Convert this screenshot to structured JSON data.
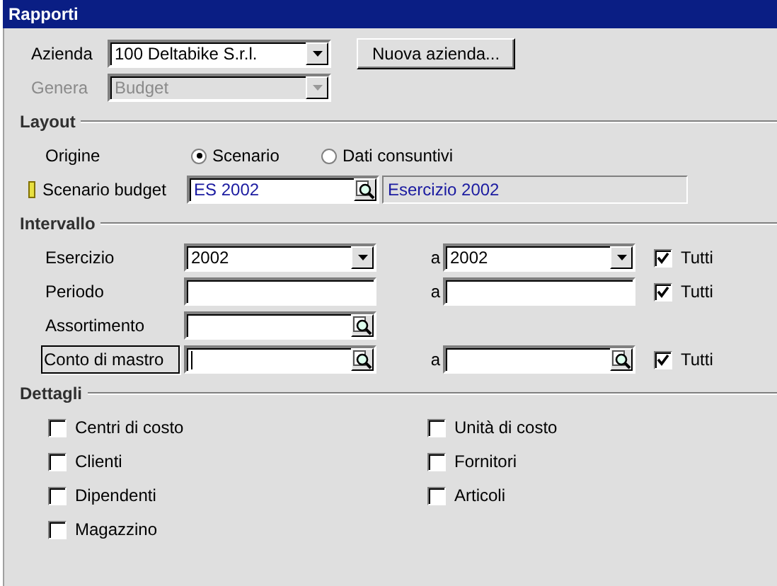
{
  "window": {
    "title": "Rapporti"
  },
  "header": {
    "azienda": {
      "label": "Azienda",
      "value": "100 Deltabike S.r.l.",
      "disabled": false
    },
    "new_button": "Nuova azienda...",
    "genera": {
      "label": "Genera",
      "value": "Budget",
      "disabled": true
    }
  },
  "layout": {
    "title": "Layout",
    "origine": {
      "label": "Origine",
      "options": [
        {
          "label": "Scenario",
          "selected": true
        },
        {
          "label": "Dati consuntivi",
          "selected": false
        }
      ]
    },
    "scenario": {
      "label": "Scenario budget",
      "value": "ES 2002",
      "description": "Esercizio 2002"
    }
  },
  "intervallo": {
    "title": "Intervallo",
    "rows": [
      {
        "label": "Esercizio",
        "kind": "dropdown",
        "focused": false,
        "from": "2002",
        "to_label": "a",
        "to": "2002",
        "all": {
          "label": "Tutti",
          "checked": true
        }
      },
      {
        "label": "Periodo",
        "kind": "text",
        "focused": false,
        "to_label": "a",
        "all": {
          "label": "Tutti",
          "checked": true
        }
      },
      {
        "label": "Assortimento",
        "kind": "lookup",
        "focused": false
      },
      {
        "label": "Conto di mastro",
        "kind": "lookup",
        "focused": true,
        "to_label": "a",
        "all": {
          "label": "Tutti",
          "checked": true
        }
      }
    ]
  },
  "dettagli": {
    "title": "Dettagli",
    "items": [
      {
        "label": "Centri di costo",
        "checked": false
      },
      {
        "label": "Unità di costo",
        "checked": false
      },
      {
        "label": "Clienti",
        "checked": false
      },
      {
        "label": "Fornitori",
        "checked": false
      },
      {
        "label": "Dipendenti",
        "checked": false
      },
      {
        "label": "Articoli",
        "checked": false
      },
      {
        "label": "Magazzino",
        "checked": false
      }
    ]
  }
}
